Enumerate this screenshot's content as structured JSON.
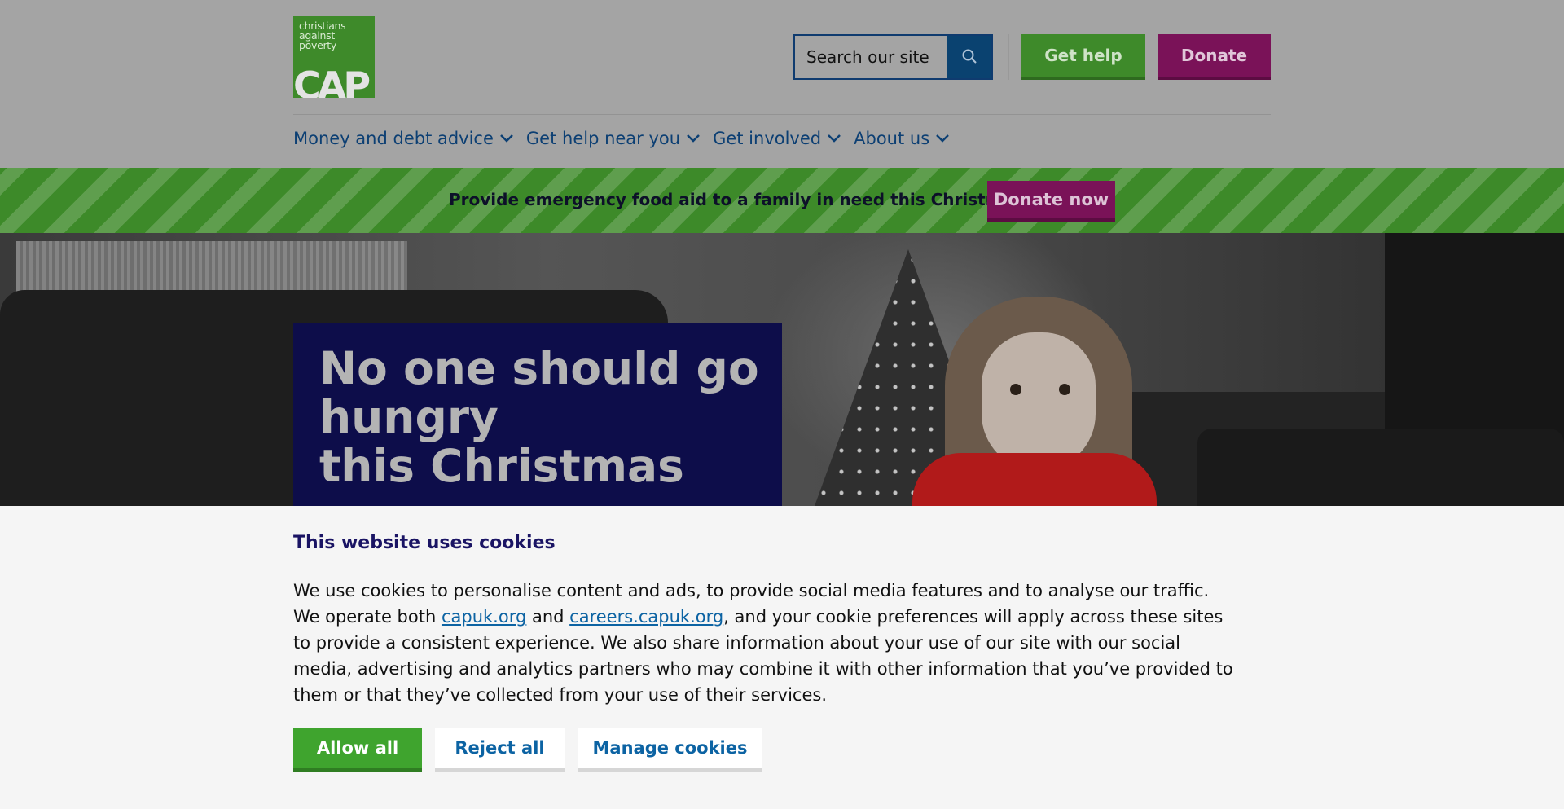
{
  "header": {
    "logo": {
      "text_lines": [
        "christians",
        "against",
        "poverty"
      ],
      "mark": "CAP",
      "brand_color": "#3e8a2a"
    },
    "search": {
      "placeholder": "Search our site",
      "icon": "search-icon"
    },
    "buttons": {
      "get_help": "Get help",
      "donate": "Donate"
    }
  },
  "nav": {
    "items": [
      {
        "label": "Money and debt advice",
        "icon": "chevron-down-icon"
      },
      {
        "label": "Get help near you",
        "icon": "chevron-down-icon"
      },
      {
        "label": "Get involved",
        "icon": "chevron-down-icon"
      },
      {
        "label": "About us",
        "icon": "chevron-down-icon"
      }
    ]
  },
  "promo": {
    "text": "Provide emergency food aid to a family in need this Christmas",
    "button": "Donate now"
  },
  "hero": {
    "title_lines": [
      "No one should go",
      "hungry",
      "this Christmas"
    ]
  },
  "cookie": {
    "title": "This website uses cookies",
    "body_part1": "We use cookies to personalise content and ads, to provide social media features and to analyse our traffic. We operate both ",
    "link1": "capuk.org",
    "body_part2": " and ",
    "link2": "careers.capuk.org",
    "body_part3": ", and your cookie preferences will apply across these sites to provide a consistent experience. We also share information about your use of our site with our social media, advertising and analytics partners who may combine it with other information that you’ve provided to them or that they’ve collected from your use of their services.",
    "buttons": {
      "allow": "Allow all",
      "reject": "Reject all",
      "manage": "Manage cookies"
    }
  },
  "colors": {
    "brand_green": "#3fa42e",
    "brand_magenta": "#7a1258",
    "navy": "#1a1464",
    "link_blue": "#0c63a3"
  }
}
